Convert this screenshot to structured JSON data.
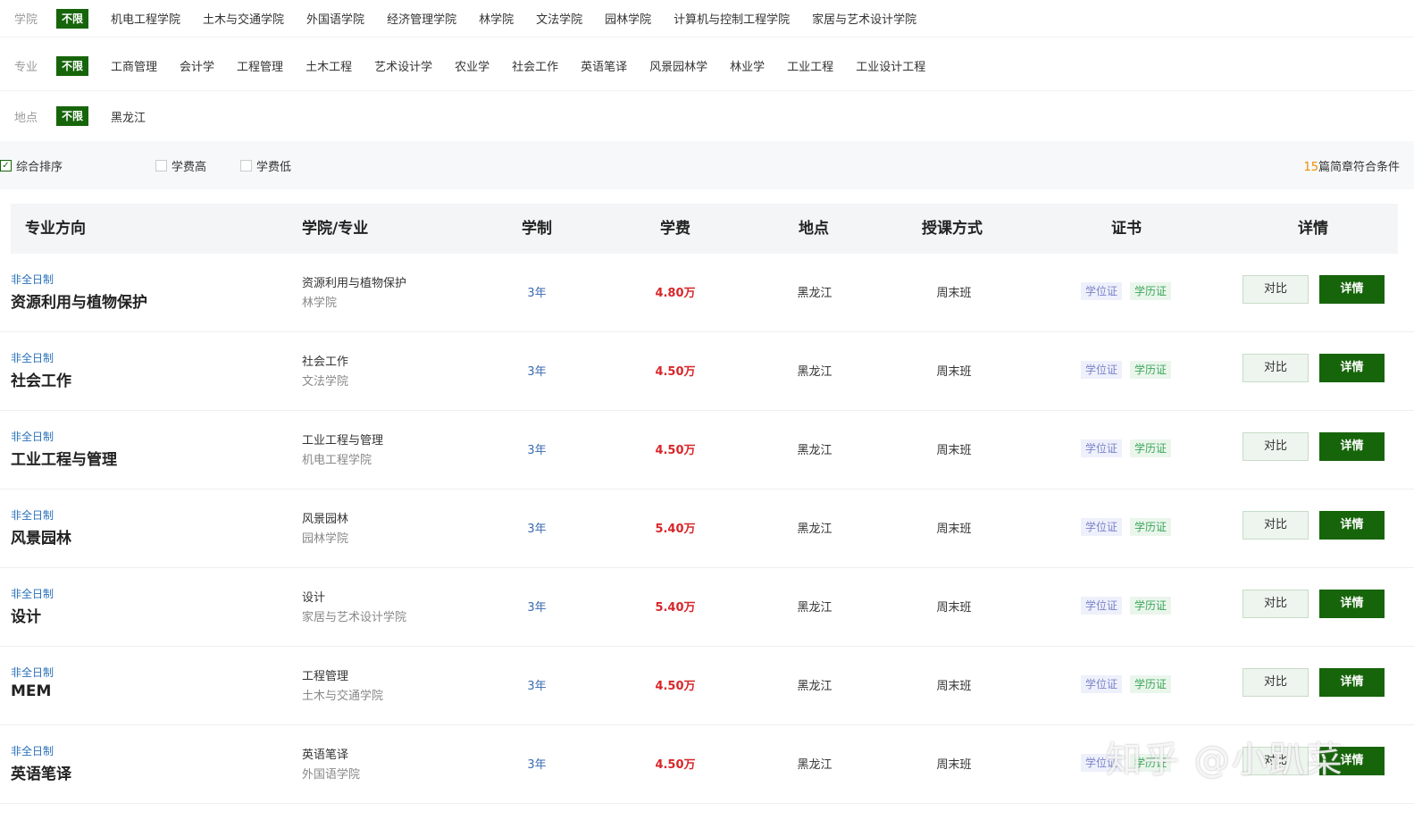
{
  "filters": {
    "college": {
      "label": "学院",
      "unlimited": "不限",
      "options": [
        "机电工程学院",
        "土木与交通学院",
        "外国语学院",
        "经济管理学院",
        "林学院",
        "文法学院",
        "园林学院",
        "计算机与控制工程学院",
        "家居与艺术设计学院"
      ]
    },
    "major": {
      "label": "专业",
      "unlimited": "不限",
      "options": [
        "工商管理",
        "会计学",
        "工程管理",
        "土木工程",
        "艺术设计学",
        "农业学",
        "社会工作",
        "英语笔译",
        "风景园林学",
        "林业学",
        "工业工程",
        "工业设计工程"
      ]
    },
    "location": {
      "label": "地点",
      "unlimited": "不限",
      "options": [
        "黑龙江"
      ]
    }
  },
  "sort": {
    "options": [
      {
        "label": "综合排序",
        "checked": true
      },
      {
        "label": "学费高",
        "checked": false
      },
      {
        "label": "学费低",
        "checked": false
      }
    ],
    "count_number": "15",
    "count_suffix": "篇简章符合条件"
  },
  "table": {
    "headers": [
      "专业方向",
      "学院/专业",
      "学制",
      "学费",
      "地点",
      "授课方式",
      "证书",
      "详情"
    ],
    "rows": [
      {
        "type": "非全日制",
        "title": "资源利用与植物保护",
        "major": "资源利用与植物保护",
        "college": "林学院",
        "duration": "3年",
        "fee": "4.80万",
        "location": "黑龙江",
        "mode": "周末班",
        "badge_degree": "学位证",
        "badge_diploma": "学历证",
        "compare": "对比",
        "detail": "详情"
      },
      {
        "type": "非全日制",
        "title": "社会工作",
        "major": "社会工作",
        "college": "文法学院",
        "duration": "3年",
        "fee": "4.50万",
        "location": "黑龙江",
        "mode": "周末班",
        "badge_degree": "学位证",
        "badge_diploma": "学历证",
        "compare": "对比",
        "detail": "详情"
      },
      {
        "type": "非全日制",
        "title": "工业工程与管理",
        "major": "工业工程与管理",
        "college": "机电工程学院",
        "duration": "3年",
        "fee": "4.50万",
        "location": "黑龙江",
        "mode": "周末班",
        "badge_degree": "学位证",
        "badge_diploma": "学历证",
        "compare": "对比",
        "detail": "详情"
      },
      {
        "type": "非全日制",
        "title": "风景园林",
        "major": "风景园林",
        "college": "园林学院",
        "duration": "3年",
        "fee": "5.40万",
        "location": "黑龙江",
        "mode": "周末班",
        "badge_degree": "学位证",
        "badge_diploma": "学历证",
        "compare": "对比",
        "detail": "详情"
      },
      {
        "type": "非全日制",
        "title": "设计",
        "major": "设计",
        "college": "家居与艺术设计学院",
        "duration": "3年",
        "fee": "5.40万",
        "location": "黑龙江",
        "mode": "周末班",
        "badge_degree": "学位证",
        "badge_diploma": "学历证",
        "compare": "对比",
        "detail": "详情"
      },
      {
        "type": "非全日制",
        "title": "MEM",
        "major": "工程管理",
        "college": "土木与交通学院",
        "duration": "3年",
        "fee": "4.50万",
        "location": "黑龙江",
        "mode": "周末班",
        "badge_degree": "学位证",
        "badge_diploma": "学历证",
        "compare": "对比",
        "detail": "详情"
      },
      {
        "type": "非全日制",
        "title": "英语笔译",
        "major": "英语笔译",
        "college": "外国语学院",
        "duration": "3年",
        "fee": "4.50万",
        "location": "黑龙江",
        "mode": "周末班",
        "badge_degree": "学位证",
        "badge_diploma": "学历证",
        "compare": "对比",
        "detail": "详情"
      }
    ]
  },
  "watermark": "知乎 @小趴菜",
  "colors": {
    "accent_green": "#17650b",
    "fee_red": "#d8262a",
    "count_orange": "#f08c00"
  }
}
